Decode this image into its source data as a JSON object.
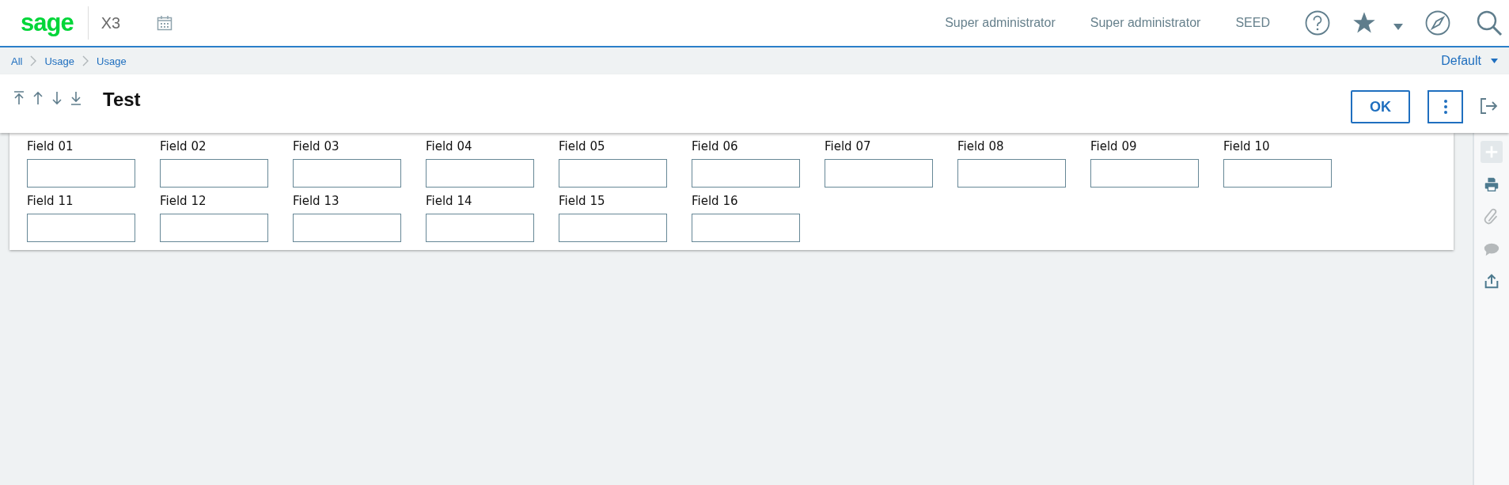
{
  "header": {
    "logo": "sage",
    "product": "X3",
    "user_links": [
      "Super administrator",
      "Super administrator",
      "SEED"
    ]
  },
  "breadcrumb": {
    "items": [
      "All",
      "Usage",
      "Usage"
    ],
    "view": "Default"
  },
  "page": {
    "title": "Test",
    "ok_button": "OK"
  },
  "fields": [
    {
      "label": "Field 01"
    },
    {
      "label": "Field 02"
    },
    {
      "label": "Field 03"
    },
    {
      "label": "Field 04"
    },
    {
      "label": "Field 05"
    },
    {
      "label": "Field 06"
    },
    {
      "label": "Field 07"
    },
    {
      "label": "Field 08"
    },
    {
      "label": "Field 09"
    },
    {
      "label": "Field 10"
    },
    {
      "label": "Field 11"
    },
    {
      "label": "Field 12"
    },
    {
      "label": "Field 13"
    },
    {
      "label": "Field 14"
    },
    {
      "label": "Field 15"
    },
    {
      "label": "Field 16"
    }
  ],
  "side_tools": [
    {
      "kind": "add",
      "disabled": true
    },
    {
      "kind": "print",
      "disabled": false
    },
    {
      "kind": "attach",
      "disabled": true
    },
    {
      "kind": "comment",
      "disabled": true
    },
    {
      "kind": "share",
      "disabled": false
    }
  ]
}
